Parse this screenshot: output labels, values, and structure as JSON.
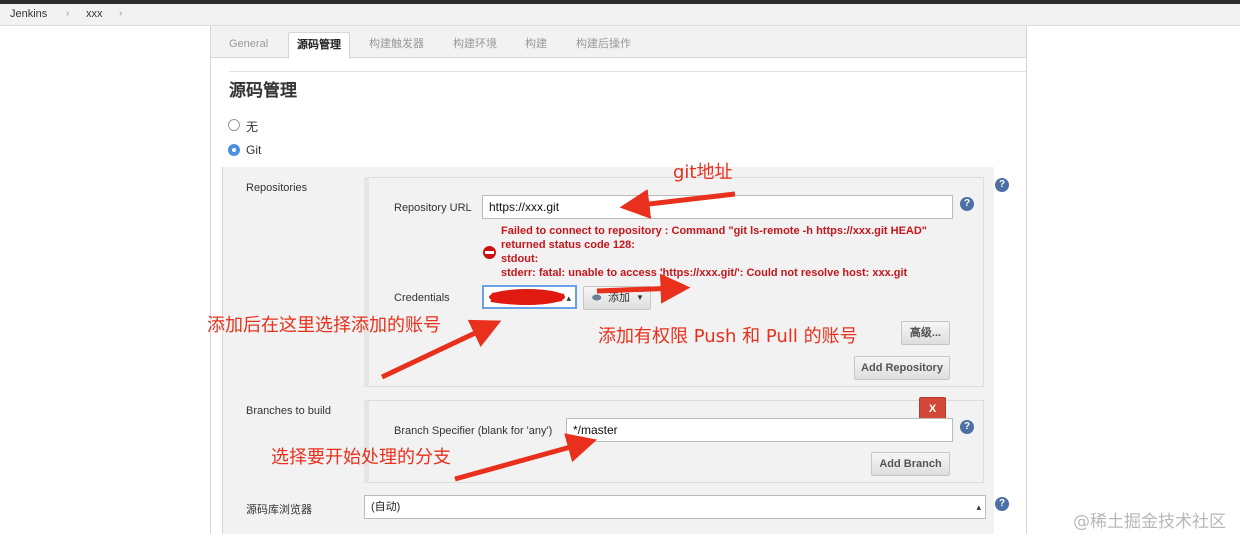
{
  "breadcrumb": {
    "items": [
      "Jenkins",
      "xxx"
    ],
    "separator": "›"
  },
  "tabs": [
    "General",
    "源码管理",
    "构建触发器",
    "构建环境",
    "构建",
    "构建后操作"
  ],
  "active_tab": "源码管理",
  "section_title": "源码管理",
  "scm_options": {
    "none_label": "无",
    "git_label": "Git",
    "selected": "Git"
  },
  "repositories": {
    "label": "Repositories",
    "url_label": "Repository URL",
    "url_value": "https://xxx.git",
    "error_lines": [
      "Failed to connect to repository : Command \"git ls-remote -h https://xxx.git HEAD\"",
      "returned status code 128:",
      "stdout:",
      "stderr: fatal: unable to access 'https://xxx.git/': Could not resolve host: xxx.git"
    ],
    "credentials_label": "Credentials",
    "add_button_label": "添加",
    "advanced_button_label": "高级...",
    "add_repository_label": "Add Repository"
  },
  "branches": {
    "label": "Branches to build",
    "delete_button_label": "X",
    "specifier_label": "Branch Specifier (blank for 'any')",
    "specifier_value": "*/master",
    "add_branch_label": "Add Branch"
  },
  "repo_browser": {
    "label": "源码库浏览器",
    "value": "(自动)"
  },
  "annotations": {
    "git_address": "git地址",
    "select_after_add": "添加后在这里选择添加的账号",
    "add_account": "添加有权限 Push 和 Pull 的账号",
    "select_branch": "选择要开始处理的分支"
  },
  "watermark": "@稀土掘金技术社区",
  "colors": {
    "accent": "#4a90e2",
    "error": "#c4161c",
    "annotation": "#e8301c",
    "help_icon": "#4c6fa5",
    "delete_button": "#d24939"
  }
}
